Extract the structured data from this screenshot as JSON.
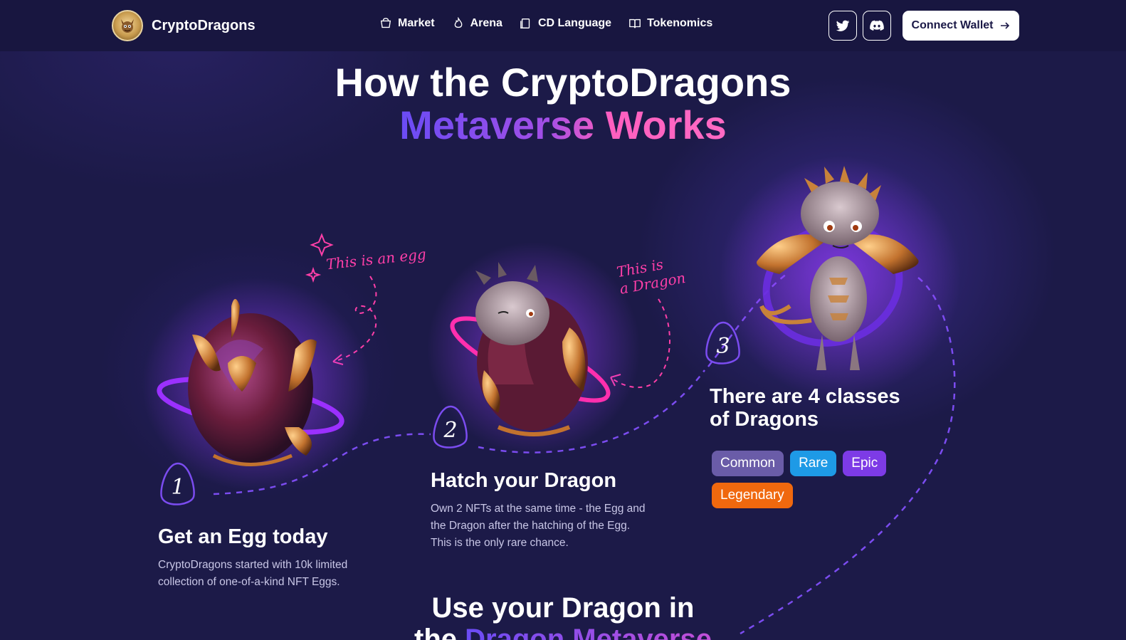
{
  "brand": {
    "name": "CryptoDragons",
    "logo_icon": "dragon-logo-icon"
  },
  "nav": {
    "items": [
      {
        "label": "Market",
        "icon": "basket-icon"
      },
      {
        "label": "Arena",
        "icon": "flame-icon"
      },
      {
        "label": "CD Language",
        "icon": "document-icon"
      },
      {
        "label": "Tokenomics",
        "icon": "book-icon"
      }
    ],
    "social": [
      {
        "name": "Twitter",
        "icon": "twitter-icon"
      },
      {
        "name": "Discord",
        "icon": "discord-icon"
      }
    ],
    "connect_label": "Connect Wallet"
  },
  "hero": {
    "line1": "How the CryptoDragons",
    "line2": "Metaverse Works"
  },
  "notes": {
    "egg": "This is an egg",
    "dragon_line1": "This is",
    "dragon_line2": "a Dragon"
  },
  "steps": [
    {
      "number": "1",
      "title": "Get an Egg today",
      "text": "CryptoDragons started with 10k limited collection of one-of-a-kind NFT Eggs."
    },
    {
      "number": "2",
      "title": "Hatch your Dragon",
      "text": "Own 2 NFTs at the same time - the Egg and the Dragon after the hatching of the Egg. This is the only rare chance."
    },
    {
      "number": "3",
      "title": "There are 4 classes of Dragons",
      "classes": [
        {
          "label": "Common",
          "color": "#6a5ca8"
        },
        {
          "label": "Rare",
          "color": "#1e9ae6"
        },
        {
          "label": "Epic",
          "color": "#7d3be6"
        },
        {
          "label": "Legendary",
          "color": "#f0680e"
        }
      ]
    }
  ],
  "next_section": {
    "line1": "Use your Dragon in",
    "line2_plain": "the",
    "line2_highlight": "Dragon Metaverse"
  },
  "colors": {
    "background": "#1c1a48",
    "navbar": "#181640",
    "accent_pink": "#ff3fa8",
    "accent_purple": "#7b4cf0"
  }
}
